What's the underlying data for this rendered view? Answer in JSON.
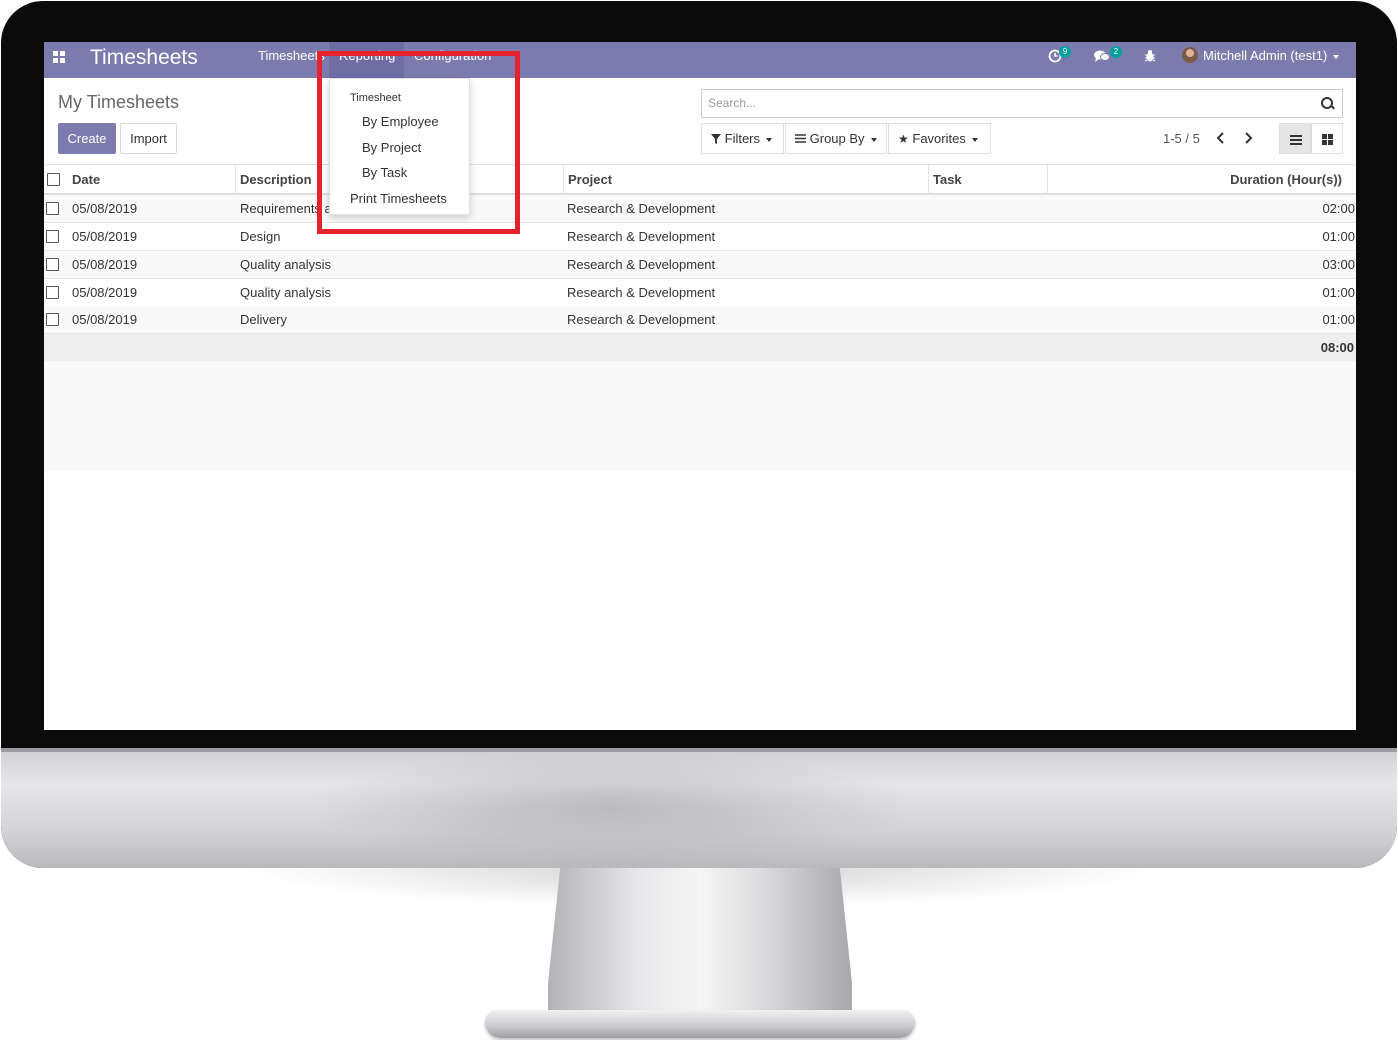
{
  "navbar": {
    "app_title": "Timesheets",
    "menus": [
      "Timesheets",
      "Reporting",
      "Configuration"
    ],
    "activity_count": "9",
    "message_count": "2",
    "user": "Mitchell Admin (test1)"
  },
  "control_panel": {
    "title": "My Timesheets",
    "create_label": "Create",
    "import_label": "Import",
    "search_placeholder": "Search...",
    "filters_label": "Filters",
    "group_by_label": "Group By",
    "favorites_label": "Favorites",
    "pager": "1-5 / 5"
  },
  "table": {
    "columns": [
      "Date",
      "Description",
      "Project",
      "Task",
      "Duration (Hour(s))"
    ],
    "rows": [
      {
        "date": "05/08/2019",
        "description": "Requirements a",
        "project": "Research & Development",
        "task": "",
        "duration": "02:00"
      },
      {
        "date": "05/08/2019",
        "description": "Design",
        "project": "Research & Development",
        "task": "",
        "duration": "01:00"
      },
      {
        "date": "05/08/2019",
        "description": "Quality analysis",
        "project": "Research & Development",
        "task": "",
        "duration": "03:00"
      },
      {
        "date": "05/08/2019",
        "description": "Quality analysis",
        "project": "Research & Development",
        "task": "",
        "duration": "01:00"
      },
      {
        "date": "05/08/2019",
        "description": "Delivery",
        "project": "Research & Development",
        "task": "",
        "duration": "01:00"
      }
    ],
    "total_duration": "08:00"
  },
  "reporting_menu": {
    "header": "Timesheet",
    "items": [
      "By Employee",
      "By Project",
      "By Task"
    ],
    "print": "Print Timesheets"
  },
  "colors": {
    "navbar": "#7c7bad",
    "primary_button": "#7c7bad",
    "badge": "#00a09d",
    "highlight": "#e6222e"
  }
}
